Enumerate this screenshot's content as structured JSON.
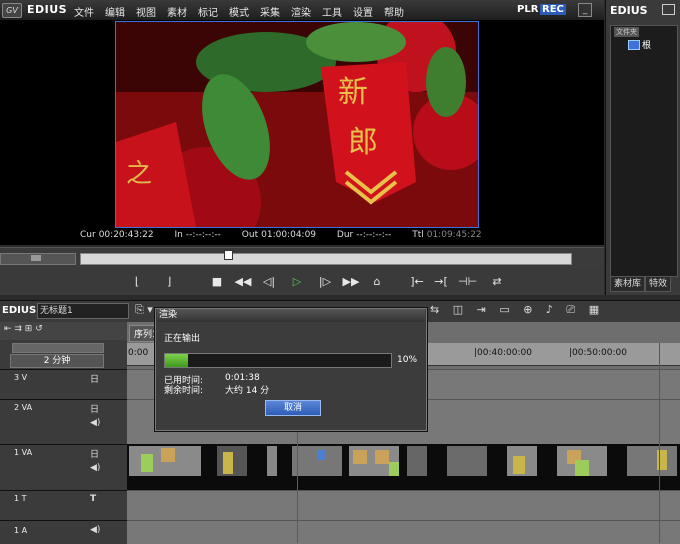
{
  "app": {
    "name": "EDIUS",
    "plr": "PLR",
    "rec": "REC"
  },
  "menu": [
    "文件",
    "编辑",
    "视图",
    "素材",
    "标记",
    "模式",
    "采集",
    "渲染",
    "工具",
    "设置",
    "帮助"
  ],
  "window_buttons": [
    "_",
    "□",
    "×"
  ],
  "player": {
    "cur_label": "Cur",
    "cur": "00:20:43:22",
    "in_label": "In",
    "in": "--:--:--:--",
    "out_label": "Out",
    "out": "01:00:04:09",
    "dur_label": "Dur",
    "dur": "--:--:--:--",
    "ttl_label": "Ttl",
    "ttl": "01:09:45:22"
  },
  "bin": {
    "title": "EDIUS",
    "folder_label": "文件夹",
    "root": "根",
    "tabs": [
      "素材库",
      "特效"
    ]
  },
  "timeline": {
    "app_label": "EDIUS",
    "sequence_name": "无标题1",
    "tab": "序列1",
    "zoom": "2 分钟",
    "ruler": [
      "0:00",
      "|00:40:00:00",
      "|00:50:00:00"
    ],
    "tracks": [
      {
        "name": "3 V"
      },
      {
        "name": "2 VA"
      },
      {
        "name": "1 VA"
      },
      {
        "name": "1 T"
      },
      {
        "name": "1 A"
      }
    ]
  },
  "dialog": {
    "title": "渲染",
    "status": "正在输出",
    "progress": 10,
    "percent_label": "10%",
    "elapsed_label": "已用时间:",
    "elapsed": "0:01:38",
    "remaining_label": "剩余时间:",
    "remaining": "大约 14 分",
    "cancel": "取消"
  },
  "colors": {
    "accent": "#2d5cb8",
    "progress": "#5bbf2a",
    "playhead": "#dd2233"
  }
}
